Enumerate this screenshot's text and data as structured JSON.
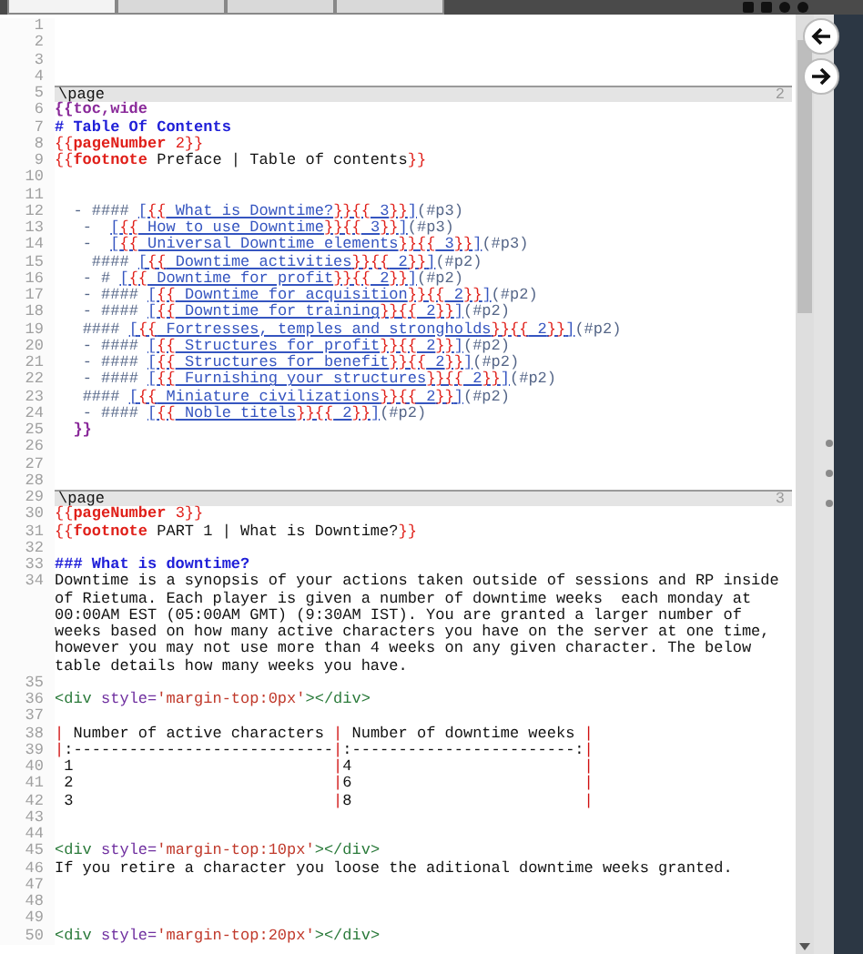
{
  "toolbar": {
    "tabs": [
      {
        "selected": true
      },
      {
        "selected": false
      },
      {
        "selected": false
      },
      {
        "selected": false
      }
    ]
  },
  "editor": {
    "lines": [
      {
        "number": "1"
      },
      {
        "number": "2"
      },
      {
        "number": "3"
      },
      {
        "number": "4"
      },
      {
        "number": "5",
        "kind": "page",
        "page_number": "2",
        "segments": [
          {
            "kind": "text",
            "text": "\\page"
          }
        ]
      },
      {
        "number": "6",
        "segments": [
          {
            "kind": "macro",
            "text": "{{toc,wide"
          }
        ]
      },
      {
        "number": "7",
        "segments": [
          {
            "kind": "heading",
            "text": "# Table Of Contents"
          }
        ]
      },
      {
        "number": "8",
        "segments": [
          {
            "kind": "tpl",
            "text": "{{"
          },
          {
            "kind": "tplb",
            "text": "pageNumber"
          },
          {
            "kind": "tpl",
            "text": " 2}}"
          }
        ]
      },
      {
        "number": "9",
        "segments": [
          {
            "kind": "tpl",
            "text": "{{"
          },
          {
            "kind": "tplb",
            "text": "footnote"
          },
          {
            "kind": "text",
            "text": " Preface | Table of contents"
          },
          {
            "kind": "tpl",
            "text": "}}"
          }
        ]
      },
      {
        "number": "10"
      },
      {
        "number": "11"
      },
      {
        "number": "12",
        "segments": [
          {
            "kind": "marker",
            "text": "  - #### "
          },
          {
            "kind": "link",
            "text": "["
          },
          {
            "kind": "brace",
            "text": "{{"
          },
          {
            "kind": "link",
            "text": " What is Downtime?"
          },
          {
            "kind": "brace",
            "text": "}}{{"
          },
          {
            "kind": "link",
            "text": " 3"
          },
          {
            "kind": "brace",
            "text": "}}"
          },
          {
            "kind": "link",
            "text": "]"
          },
          {
            "kind": "marker",
            "text": "(#p3)"
          }
        ]
      },
      {
        "number": "13",
        "segments": [
          {
            "kind": "marker",
            "text": "   -  "
          },
          {
            "kind": "link",
            "text": "["
          },
          {
            "kind": "brace",
            "text": "{{"
          },
          {
            "kind": "link",
            "text": " How to use Downtime"
          },
          {
            "kind": "brace",
            "text": "}}{{"
          },
          {
            "kind": "link",
            "text": " 3"
          },
          {
            "kind": "brace",
            "text": "}}"
          },
          {
            "kind": "link",
            "text": "]"
          },
          {
            "kind": "marker",
            "text": "(#p3)"
          }
        ]
      },
      {
        "number": "14",
        "segments": [
          {
            "kind": "marker",
            "text": "   -  "
          },
          {
            "kind": "link",
            "text": "["
          },
          {
            "kind": "brace",
            "text": "{{"
          },
          {
            "kind": "link",
            "text": " Universal Downtime elements"
          },
          {
            "kind": "brace",
            "text": "}}{{"
          },
          {
            "kind": "link",
            "text": " 3"
          },
          {
            "kind": "brace",
            "text": "}}"
          },
          {
            "kind": "link",
            "text": "]"
          },
          {
            "kind": "marker",
            "text": "(#p3)"
          }
        ]
      },
      {
        "number": "15",
        "segments": [
          {
            "kind": "marker",
            "text": "    #### "
          },
          {
            "kind": "link",
            "text": "["
          },
          {
            "kind": "brace",
            "text": "{{"
          },
          {
            "kind": "link",
            "text": " Downtime activities"
          },
          {
            "kind": "brace",
            "text": "}}{{"
          },
          {
            "kind": "link",
            "text": " 2"
          },
          {
            "kind": "brace",
            "text": "}}"
          },
          {
            "kind": "link",
            "text": "]"
          },
          {
            "kind": "marker",
            "text": "(#p2)"
          }
        ]
      },
      {
        "number": "16",
        "segments": [
          {
            "kind": "marker",
            "text": "   - # "
          },
          {
            "kind": "link",
            "text": "["
          },
          {
            "kind": "brace",
            "text": "{{"
          },
          {
            "kind": "link",
            "text": " Downtime for profit"
          },
          {
            "kind": "brace",
            "text": "}}{{"
          },
          {
            "kind": "link",
            "text": " 2"
          },
          {
            "kind": "brace",
            "text": "}}"
          },
          {
            "kind": "link",
            "text": "]"
          },
          {
            "kind": "marker",
            "text": "(#p2)"
          }
        ]
      },
      {
        "number": "17",
        "segments": [
          {
            "kind": "marker",
            "text": "   - #### "
          },
          {
            "kind": "link",
            "text": "["
          },
          {
            "kind": "brace",
            "text": "{{"
          },
          {
            "kind": "link",
            "text": " Downtime for acquisition"
          },
          {
            "kind": "brace",
            "text": "}}{{"
          },
          {
            "kind": "link",
            "text": " 2"
          },
          {
            "kind": "brace",
            "text": "}}"
          },
          {
            "kind": "link",
            "text": "]"
          },
          {
            "kind": "marker",
            "text": "(#p2)"
          }
        ]
      },
      {
        "number": "18",
        "segments": [
          {
            "kind": "marker",
            "text": "   - #### "
          },
          {
            "kind": "link",
            "text": "["
          },
          {
            "kind": "brace",
            "text": "{{"
          },
          {
            "kind": "link",
            "text": " Downtime for training"
          },
          {
            "kind": "brace",
            "text": "}}{{"
          },
          {
            "kind": "link",
            "text": " 2"
          },
          {
            "kind": "brace",
            "text": "}}"
          },
          {
            "kind": "link",
            "text": "]"
          },
          {
            "kind": "marker",
            "text": "(#p2)"
          }
        ]
      },
      {
        "number": "19",
        "segments": [
          {
            "kind": "marker",
            "text": "   #### "
          },
          {
            "kind": "link",
            "text": "["
          },
          {
            "kind": "brace",
            "text": "{{"
          },
          {
            "kind": "link",
            "text": " Fortresses, temples and strongholds"
          },
          {
            "kind": "brace",
            "text": "}}{{"
          },
          {
            "kind": "link",
            "text": " 2"
          },
          {
            "kind": "brace",
            "text": "}}"
          },
          {
            "kind": "link",
            "text": "]"
          },
          {
            "kind": "marker",
            "text": "(#p2)"
          }
        ]
      },
      {
        "number": "20",
        "segments": [
          {
            "kind": "marker",
            "text": "   - #### "
          },
          {
            "kind": "link",
            "text": "["
          },
          {
            "kind": "brace",
            "text": "{{"
          },
          {
            "kind": "link",
            "text": " Structures for profit"
          },
          {
            "kind": "brace",
            "text": "}}{{"
          },
          {
            "kind": "link",
            "text": " 2"
          },
          {
            "kind": "brace",
            "text": "}}"
          },
          {
            "kind": "link",
            "text": "]"
          },
          {
            "kind": "marker",
            "text": "(#p2)"
          }
        ]
      },
      {
        "number": "21",
        "segments": [
          {
            "kind": "marker",
            "text": "   - #### "
          },
          {
            "kind": "link",
            "text": "["
          },
          {
            "kind": "brace",
            "text": "{{"
          },
          {
            "kind": "link",
            "text": " Structures for benefit"
          },
          {
            "kind": "brace",
            "text": "}}{{"
          },
          {
            "kind": "link",
            "text": " 2"
          },
          {
            "kind": "brace",
            "text": "}}"
          },
          {
            "kind": "link",
            "text": "]"
          },
          {
            "kind": "marker",
            "text": "(#p2)"
          }
        ]
      },
      {
        "number": "22",
        "segments": [
          {
            "kind": "marker",
            "text": "   - #### "
          },
          {
            "kind": "link",
            "text": "["
          },
          {
            "kind": "brace",
            "text": "{{"
          },
          {
            "kind": "link",
            "text": " Furnishing your structures"
          },
          {
            "kind": "brace",
            "text": "}}{{"
          },
          {
            "kind": "link",
            "text": " 2"
          },
          {
            "kind": "brace",
            "text": "}}"
          },
          {
            "kind": "link",
            "text": "]"
          },
          {
            "kind": "marker",
            "text": "(#p2)"
          }
        ]
      },
      {
        "number": "23",
        "segments": [
          {
            "kind": "marker",
            "text": "   #### "
          },
          {
            "kind": "link",
            "text": "["
          },
          {
            "kind": "brace",
            "text": "{{"
          },
          {
            "kind": "link",
            "text": " Miniature civilizations"
          },
          {
            "kind": "brace",
            "text": "}}{{"
          },
          {
            "kind": "link",
            "text": " 2"
          },
          {
            "kind": "brace",
            "text": "}}"
          },
          {
            "kind": "link",
            "text": "]"
          },
          {
            "kind": "marker",
            "text": "(#p2)"
          }
        ]
      },
      {
        "number": "24",
        "segments": [
          {
            "kind": "marker",
            "text": "   - #### "
          },
          {
            "kind": "link",
            "text": "["
          },
          {
            "kind": "brace",
            "text": "{{"
          },
          {
            "kind": "link",
            "text": " Noble titels"
          },
          {
            "kind": "brace",
            "text": "}}{{"
          },
          {
            "kind": "link",
            "text": " 2"
          },
          {
            "kind": "brace",
            "text": "}}"
          },
          {
            "kind": "link",
            "text": "]"
          },
          {
            "kind": "marker",
            "text": "(#p2)"
          }
        ]
      },
      {
        "number": "25",
        "segments": [
          {
            "kind": "macro",
            "text": "  }}"
          }
        ]
      },
      {
        "number": "26"
      },
      {
        "number": "27"
      },
      {
        "number": "28"
      },
      {
        "number": "29",
        "kind": "page",
        "page_number": "3",
        "segments": [
          {
            "kind": "text",
            "text": "\\page"
          }
        ]
      },
      {
        "number": "30",
        "segments": [
          {
            "kind": "tpl",
            "text": "{{"
          },
          {
            "kind": "tplb",
            "text": "pageNumber"
          },
          {
            "kind": "tpl",
            "text": " 3}}"
          }
        ]
      },
      {
        "number": "31",
        "segments": [
          {
            "kind": "tpl",
            "text": "{{"
          },
          {
            "kind": "tplb",
            "text": "footnote"
          },
          {
            "kind": "text",
            "text": " PART 1 | What is Downtime?"
          },
          {
            "kind": "tpl",
            "text": "}}"
          }
        ]
      },
      {
        "number": "32"
      },
      {
        "number": "33",
        "segments": [
          {
            "kind": "heading",
            "text": "### What is downtime?"
          }
        ]
      },
      {
        "number": "34",
        "segments": [
          {
            "kind": "text",
            "text": "Downtime is a synopsis of your actions taken outside of sessions and RP inside of Rietuma. Each player is given a number of downtime weeks  each monday at 00:00AM EST (05:00AM GMT) (9:30AM IST). You are granted a larger number of weeks based on how many active characters you have on the server at one time, however you may not use more than 4 weeks on any given character. The below table details how many weeks you have."
          }
        ]
      },
      {
        "number": "35"
      },
      {
        "number": "36",
        "segments": [
          {
            "kind": "tag",
            "text": "<div "
          },
          {
            "kind": "attr",
            "text": "style="
          },
          {
            "kind": "value",
            "text": "'margin-top:0px'"
          },
          {
            "kind": "tag",
            "text": "></div>"
          }
        ]
      },
      {
        "number": "37"
      },
      {
        "number": "38",
        "segments": [
          {
            "kind": "pipe",
            "text": "|"
          },
          {
            "kind": "text",
            "text": " Number of active characters "
          },
          {
            "kind": "pipe",
            "text": "|"
          },
          {
            "kind": "text",
            "text": " Number of downtime weeks "
          },
          {
            "kind": "pipe",
            "text": "|"
          }
        ]
      },
      {
        "number": "39",
        "segments": [
          {
            "kind": "pipe",
            "text": "|"
          },
          {
            "kind": "text",
            "text": ":----------------------------"
          },
          {
            "kind": "pipe",
            "text": "|"
          },
          {
            "kind": "text",
            "text": ":------------------------:"
          },
          {
            "kind": "pipe",
            "text": "|"
          }
        ]
      },
      {
        "number": "40",
        "segments": [
          {
            "kind": "text",
            "text": " 1                            "
          },
          {
            "kind": "pipe",
            "text": "|"
          },
          {
            "kind": "text",
            "text": "4                         "
          },
          {
            "kind": "pipe",
            "text": "|"
          }
        ]
      },
      {
        "number": "41",
        "segments": [
          {
            "kind": "text",
            "text": " 2                            "
          },
          {
            "kind": "pipe",
            "text": "|"
          },
          {
            "kind": "text",
            "text": "6                         "
          },
          {
            "kind": "pipe",
            "text": "|"
          }
        ]
      },
      {
        "number": "42",
        "segments": [
          {
            "kind": "text",
            "text": " 3                            "
          },
          {
            "kind": "pipe",
            "text": "|"
          },
          {
            "kind": "text",
            "text": "8                         "
          },
          {
            "kind": "pipe",
            "text": "|"
          }
        ]
      },
      {
        "number": "43"
      },
      {
        "number": "44"
      },
      {
        "number": "45",
        "segments": [
          {
            "kind": "tag",
            "text": "<div "
          },
          {
            "kind": "attr",
            "text": "style="
          },
          {
            "kind": "value",
            "text": "'margin-top:10px'"
          },
          {
            "kind": "tag",
            "text": "></div>"
          }
        ]
      },
      {
        "number": "46",
        "segments": [
          {
            "kind": "text",
            "text": "If you retire a character you loose the aditional downtime weeks granted."
          }
        ]
      },
      {
        "number": "47"
      },
      {
        "number": "48"
      },
      {
        "number": "49"
      },
      {
        "number": "50",
        "segments": [
          {
            "kind": "tag",
            "text": "<div "
          },
          {
            "kind": "attr",
            "text": "style="
          },
          {
            "kind": "value",
            "text": "'margin-top:20px'"
          },
          {
            "kind": "tag",
            "text": "></div>"
          }
        ]
      }
    ]
  }
}
